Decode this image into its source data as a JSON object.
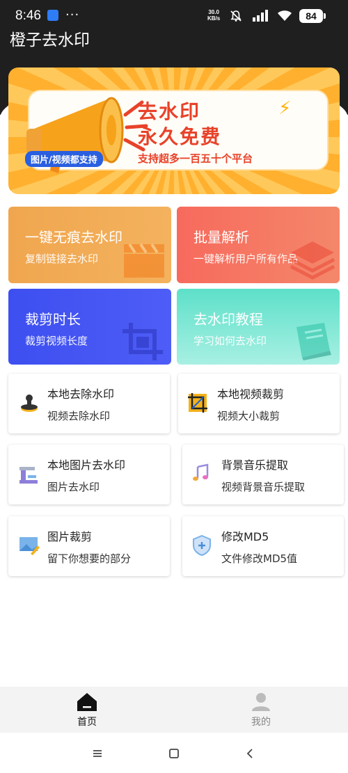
{
  "status_bar": {
    "time": "8:46",
    "dots": "···",
    "speed_value": "30.0",
    "speed_unit": "KB/s",
    "battery": "84",
    "icons": [
      "message-icon",
      "mute-bell-icon",
      "signal-icon",
      "wifi-icon",
      "battery-icon"
    ]
  },
  "app": {
    "title": "橙子去水印"
  },
  "banner": {
    "headline_1": "去水印",
    "headline_2": "永久免费",
    "tag": "图片/视频都支持",
    "subline": "支持超多一百五十个平台"
  },
  "tiles": [
    {
      "title": "一键无痕去水印",
      "subtitle": "复制链接去水印",
      "icon": "clapperboard-icon",
      "color": "#f0a64f"
    },
    {
      "title": "批量解析",
      "subtitle": "一键解析用户所有作品",
      "icon": "layers-icon",
      "color": "#f76a5d"
    },
    {
      "title": "裁剪时长",
      "subtitle": "裁剪视频长度",
      "icon": "crop-frame-icon",
      "color": "#3d4ff0"
    },
    {
      "title": "去水印教程",
      "subtitle": "学习如何去水印",
      "icon": "book-icon",
      "color": "#5de0c9"
    }
  ],
  "cards": [
    {
      "title": "本地去除水印",
      "subtitle": "视频去除水印",
      "icon": "stamp-icon"
    },
    {
      "title": "本地视频裁剪",
      "subtitle": "视频大小裁剪",
      "icon": "crop-icon"
    },
    {
      "title": "本地图片去水印",
      "subtitle": "图片去水印",
      "icon": "faucet-icon"
    },
    {
      "title": "背景音乐提取",
      "subtitle": "视频背景音乐提取",
      "icon": "music-note-icon"
    },
    {
      "title": "图片裁剪",
      "subtitle": "留下你想要的部分",
      "icon": "image-edit-icon"
    },
    {
      "title": "修改MD5",
      "subtitle": "文件修改MD5值",
      "icon": "shield-plus-icon"
    }
  ],
  "bottom_nav": [
    {
      "label": "首页",
      "icon": "home-icon",
      "active": true
    },
    {
      "label": "我的",
      "icon": "person-icon",
      "active": false
    }
  ],
  "system_nav": [
    "menu-icon",
    "home-square-icon",
    "back-icon"
  ]
}
